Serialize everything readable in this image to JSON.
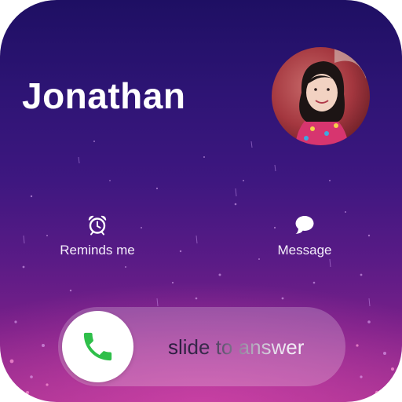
{
  "call": {
    "caller_name": "Jonathan",
    "avatar_icon": "caller-photo"
  },
  "actions": {
    "remind": {
      "label": "Reminds me",
      "icon": "alarm-clock-icon"
    },
    "message": {
      "label": "Message",
      "icon": "speech-bubble-icon"
    }
  },
  "slider": {
    "text": "slide to answer",
    "icon": "phone-icon",
    "accent_color": "#2fbf4a"
  },
  "colors": {
    "background_top": "#1e0f63",
    "background_bottom": "#a1308f",
    "text": "#ffffff"
  }
}
